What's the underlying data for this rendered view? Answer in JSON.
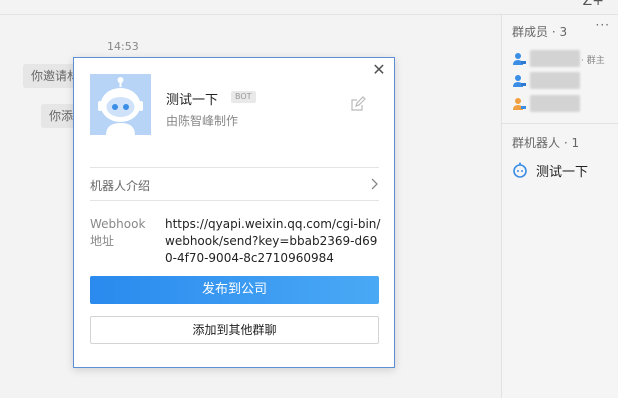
{
  "topbar": {
    "add_icon": "add-person-icon"
  },
  "chat": {
    "time": "14:53",
    "system_messages": [
      "你邀请林",
      "你添"
    ]
  },
  "members_panel": {
    "members_title": "群成员 · 3",
    "members": [
      {
        "owner_tag": "· 群主",
        "icon": "person-icon",
        "color": "#3a8ee6"
      },
      {
        "owner_tag": "",
        "icon": "person-icon",
        "color": "#3a8ee6"
      },
      {
        "owner_tag": "",
        "icon": "person-icon",
        "color": "#f0a040"
      }
    ],
    "bots_title": "群机器人 · 1",
    "bots": [
      {
        "name": "测试一下",
        "icon": "bot-icon"
      }
    ]
  },
  "popup": {
    "bot_name": "测试一下",
    "badge": "BOT",
    "creator": "由陈智峰制作",
    "intro_label": "机器人介绍",
    "webhook_label": "Webhook地址",
    "webhook_url": "https://qyapi.weixin.qq.com/cgi-bin/webhook/send?key=bbab2369-d690-4f70-9004-8c2710960984",
    "publish_button": "发布到公司",
    "add_group_button": "添加到其他群聊"
  },
  "colors": {
    "accent": "#2a8aee",
    "popup_border": "#5b8fd6",
    "avatar_bg": "#b7d3f6"
  }
}
